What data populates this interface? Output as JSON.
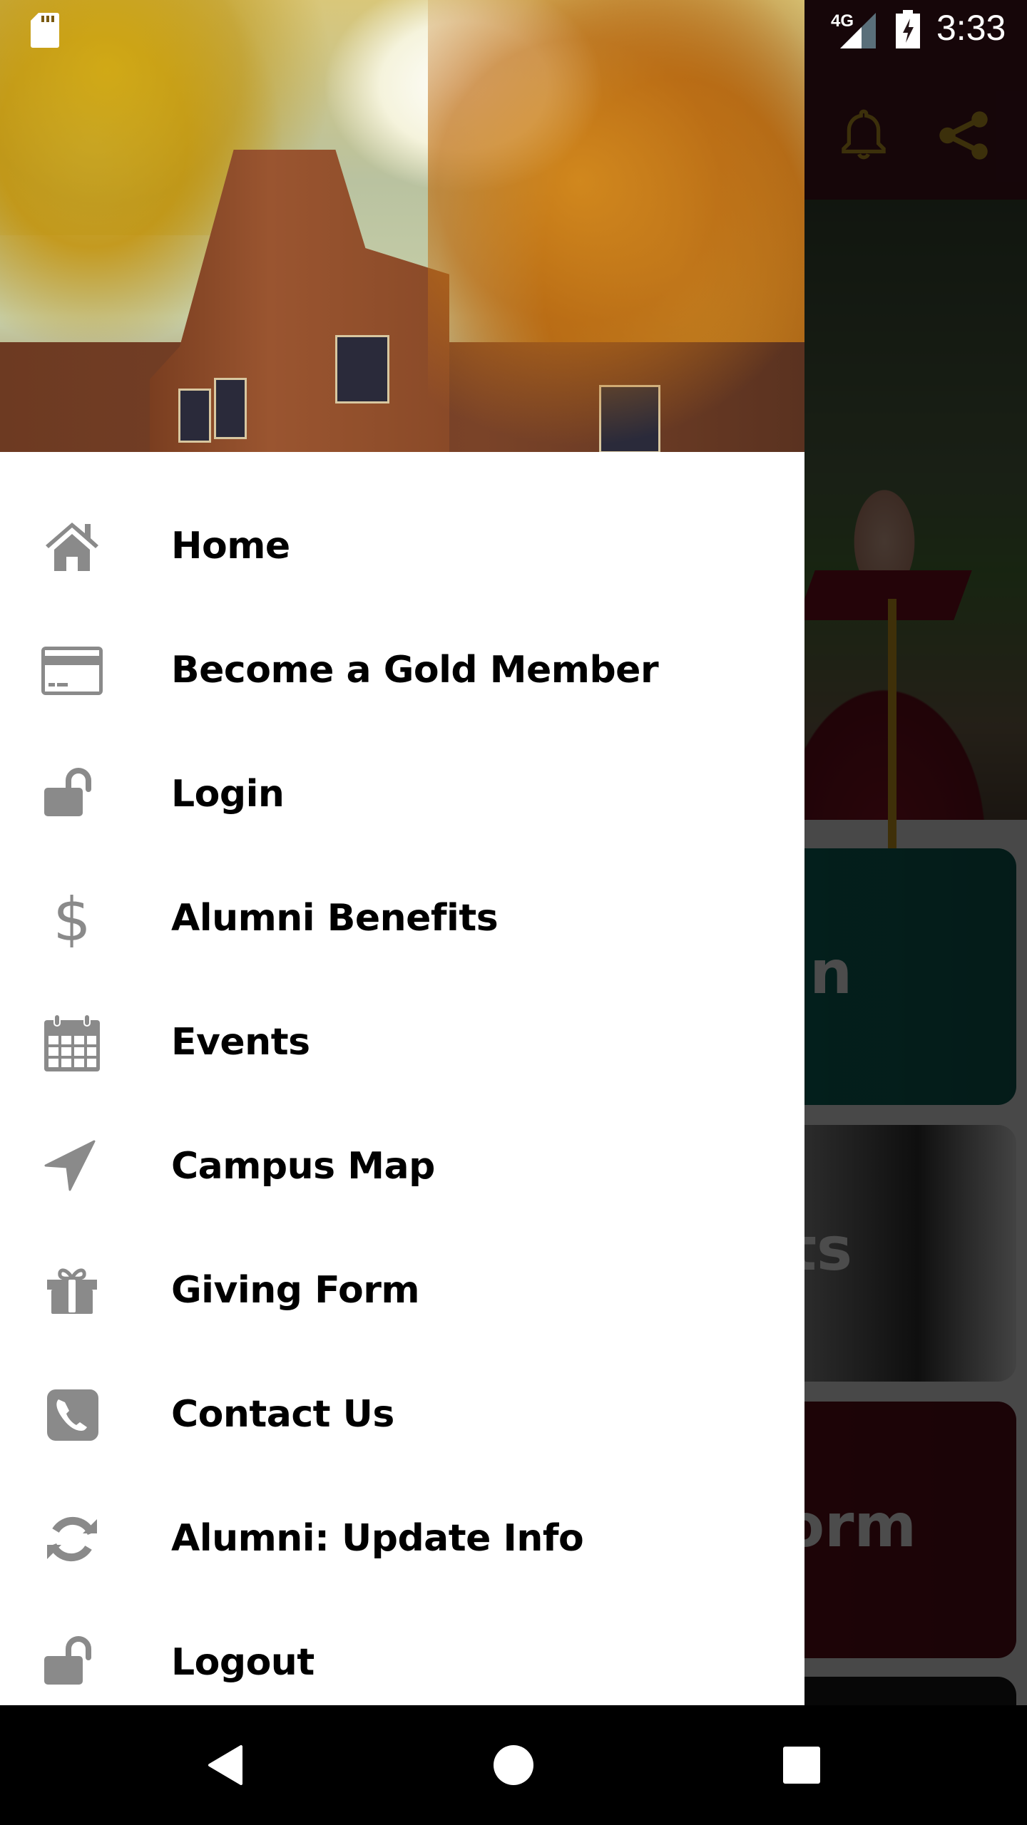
{
  "status_bar": {
    "network": "4G",
    "time": "3:33",
    "icons": [
      "sd-card-icon",
      "signal-icon",
      "battery-charging-icon"
    ]
  },
  "app_bar": {
    "actions": [
      {
        "name": "notifications",
        "icon": "bell-icon"
      },
      {
        "name": "share",
        "icon": "share-icon"
      }
    ],
    "accent_color": "#c9a227"
  },
  "background_cards": [
    {
      "title_fragment": "n"
    },
    {
      "title_fragment": "ts"
    },
    {
      "title_fragment": "Form"
    }
  ],
  "drawer": {
    "menu": [
      {
        "label": "Home",
        "icon": "home-icon"
      },
      {
        "label": "Become a Gold Member",
        "icon": "credit-card-icon"
      },
      {
        "label": "Login",
        "icon": "unlock-icon"
      },
      {
        "label": "Alumni Benefits",
        "icon": "dollar-icon"
      },
      {
        "label": "Events",
        "icon": "calendar-icon"
      },
      {
        "label": "Campus Map",
        "icon": "location-arrow-icon"
      },
      {
        "label": "Giving Form",
        "icon": "gift-icon"
      },
      {
        "label": "Contact Us",
        "icon": "phone-icon"
      },
      {
        "label": "Alumni: Update Info",
        "icon": "refresh-icon"
      },
      {
        "label": "Logout",
        "icon": "unlock-icon"
      }
    ],
    "icon_color": "#8a8a8a"
  },
  "nav_bar": {
    "buttons": [
      {
        "name": "back",
        "icon": "back-triangle-icon"
      },
      {
        "name": "home",
        "icon": "home-circle-icon"
      },
      {
        "name": "recents",
        "icon": "recents-square-icon"
      }
    ]
  }
}
